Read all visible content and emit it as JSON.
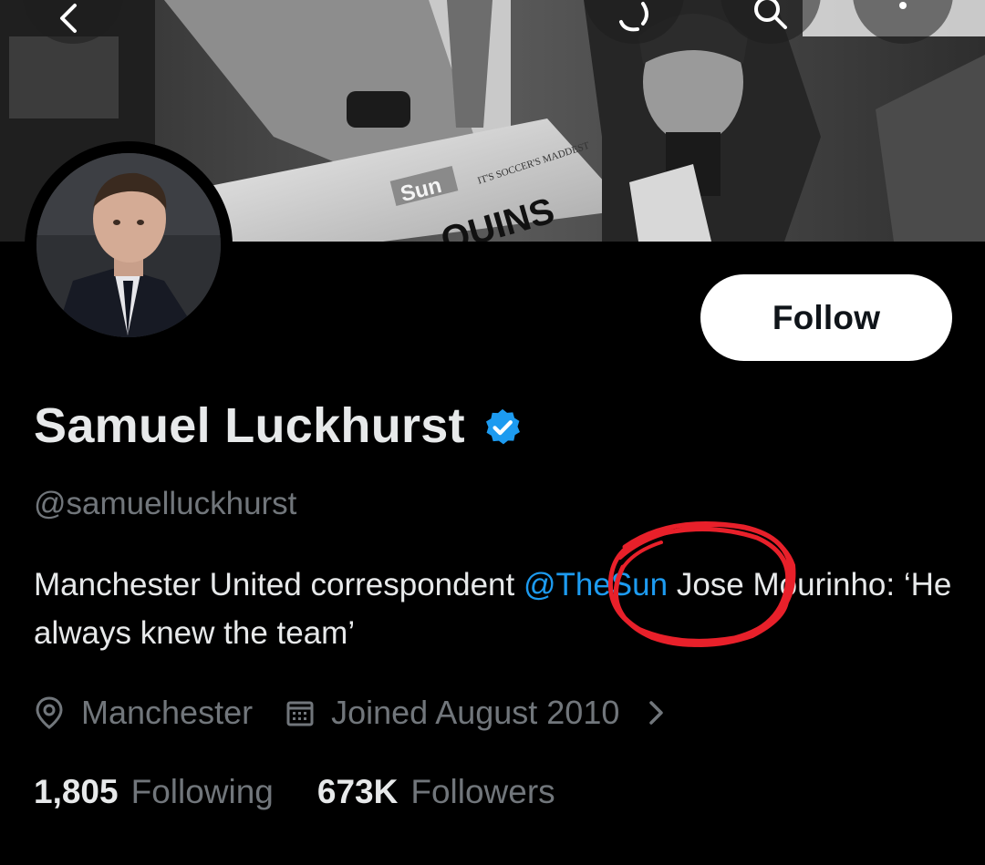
{
  "profile": {
    "display_name": "Samuel Luckhurst",
    "handle": "@samuelluckhurst",
    "bio_prefix": "Manchester United correspondent ",
    "bio_mention": "@TheSun",
    "bio_suffix": " Jose Mourinho: ‘He always knew the team’",
    "location": "Manchester",
    "joined": "Joined August 2010",
    "following_count": "1,805",
    "following_label": "Following",
    "followers_count": "673K",
    "followers_label": "Followers"
  },
  "actions": {
    "follow_label": "Follow"
  },
  "banner": {
    "newspaper_masthead": "Sun",
    "newspaper_headline": "QUINS",
    "newspaper_strap": "IT'S SOCCER'S MADDEST"
  },
  "icons": {
    "back": "back-arrow-icon",
    "retweet": "retweet-icon",
    "search": "search-icon",
    "more": "more-icon",
    "verified": "verified-badge-icon",
    "location": "location-pin-icon",
    "calendar": "calendar-icon",
    "chevron": "chevron-right-icon"
  },
  "colors": {
    "background": "#000000",
    "primary_text": "#e7e9ea",
    "secondary_text": "#71767b",
    "link": "#1d9bf0",
    "verified": "#1d9bf0",
    "annotation": "#e8202a",
    "follow_button_bg": "#ffffff"
  }
}
